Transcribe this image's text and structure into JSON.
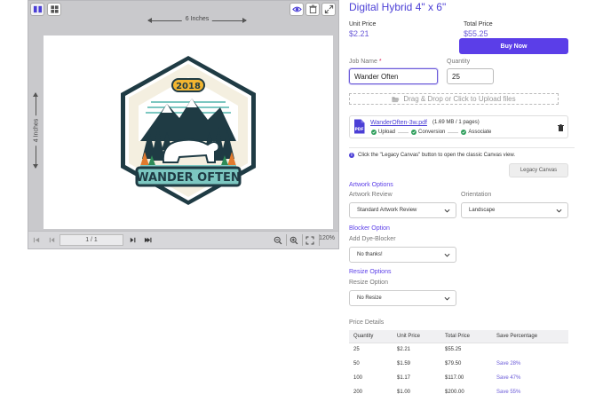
{
  "preview": {
    "width_label": "6 Inches",
    "height_label": "4 Inches",
    "page_indicator": "1 / 1",
    "zoom": "120%",
    "artwork": {
      "year": "2018",
      "banner_text": "WANDER OFTEN"
    }
  },
  "product": {
    "title": "Digital Hybrid 4\" x 6\"",
    "unit_price_label": "Unit Price",
    "unit_price": "$2.21",
    "total_price_label": "Total Price",
    "total_price": "$55.25",
    "buy_label": "Buy Now"
  },
  "form": {
    "job_name_label": "Job Name",
    "job_name_required": "*",
    "job_name_value": "Wander Often",
    "quantity_label": "Quantity",
    "quantity_value": "25",
    "upload_text": "Drag & Drop or Click to Upload files"
  },
  "file": {
    "name": "WanderOften-3w.pdf",
    "meta": "(1.69 MB / 1 pages)",
    "steps": [
      "Upload",
      "Conversion",
      "Associate"
    ]
  },
  "info": {
    "text": "Click the \"Legacy Canvas\" button to open the classic Canvas view.",
    "legacy_button": "Legacy Canvas"
  },
  "artwork_options": {
    "title": "Artwork Options",
    "review_label": "Artwork Review",
    "review_value": "Standard Artwork Review",
    "orientation_label": "Orientation",
    "orientation_value": "Landscape"
  },
  "blocker": {
    "title": "Blocker Option",
    "label": "Add Dye-Blocker",
    "value": "No thanks!"
  },
  "resize": {
    "title": "Resize Options",
    "label": "Resize Option",
    "value": "No Resize"
  },
  "price_details": {
    "title": "Price Details",
    "headers": [
      "Quantity",
      "Unit Price",
      "Total Price",
      "Save Percentage"
    ],
    "rows": [
      [
        "25",
        "$2.21",
        "$55.25",
        ""
      ],
      [
        "50",
        "$1.59",
        "$79.50",
        "Save 28%"
      ],
      [
        "100",
        "$1.17",
        "$117.00",
        "Save 47%"
      ],
      [
        "200",
        "$1.00",
        "$200.00",
        "Save 55%"
      ]
    ]
  },
  "colors": {
    "accent": "#5b3ee8",
    "link": "#4b3fd6",
    "success": "#2e9e5b"
  }
}
